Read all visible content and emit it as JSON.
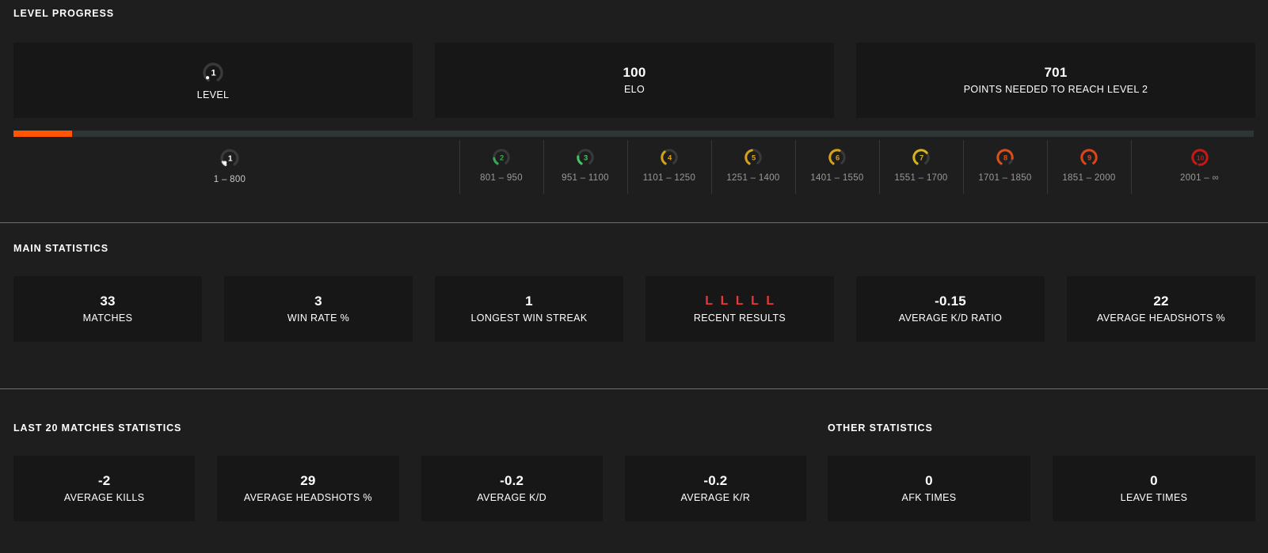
{
  "theme": {
    "page_bg": "#1e1e1e",
    "card_bg": "#171717",
    "accent_orange": "#ff5500",
    "loss_red": "#e33a3a",
    "muted_text": "#9a9a9a",
    "divider": "#6e6e6e"
  },
  "level_progress": {
    "title": "LEVEL PROGRESS",
    "cards": [
      {
        "type": "level-badge",
        "badge_number": "1",
        "label": "LEVEL"
      },
      {
        "type": "value",
        "value": "100",
        "label": "ELO"
      },
      {
        "type": "value",
        "value": "701",
        "label": "POINTS NEEDED TO REACH LEVEL 2"
      }
    ],
    "progress": {
      "percent": 4.7,
      "fill_color": "#ff5500",
      "track_color": "#2e3536"
    },
    "tiers": [
      {
        "level": "1",
        "range": "1 – 800",
        "color": "#d8d8d8",
        "arc_pct": 8,
        "current": true
      },
      {
        "level": "2",
        "range": "801 – 950",
        "color": "#2fae52",
        "arc_pct": 14,
        "current": false
      },
      {
        "level": "3",
        "range": "951 – 1100",
        "color": "#3fc95f",
        "arc_pct": 18,
        "current": false
      },
      {
        "level": "4",
        "range": "1101 – 1250",
        "color": "#d8a216",
        "arc_pct": 30,
        "current": false
      },
      {
        "level": "5",
        "range": "1251 – 1400",
        "color": "#d8a216",
        "arc_pct": 38,
        "current": false
      },
      {
        "level": "6",
        "range": "1401 – 1550",
        "color": "#d8a216",
        "arc_pct": 46,
        "current": false
      },
      {
        "level": "7",
        "range": "1551 – 1700",
        "color": "#d8b516",
        "arc_pct": 55,
        "current": false
      },
      {
        "level": "8",
        "range": "1701 – 1850",
        "color": "#dd4f16",
        "arc_pct": 68,
        "current": false
      },
      {
        "level": "9",
        "range": "1851 – 2000",
        "color": "#dd4516",
        "arc_pct": 80,
        "current": false
      },
      {
        "level": "10",
        "range": "2001 – ∞",
        "color": "#cc1616",
        "arc_pct": 92,
        "current": false
      }
    ]
  },
  "main_statistics": {
    "title": "MAIN STATISTICS",
    "cards": [
      {
        "value": "33",
        "label": "MATCHES"
      },
      {
        "value": "3",
        "label": "WIN RATE %"
      },
      {
        "value": "1",
        "label": "LONGEST WIN STREAK"
      },
      {
        "value": "",
        "label": "RECENT RESULTS",
        "results": [
          "L",
          "L",
          "L",
          "L",
          "L"
        ]
      },
      {
        "value": "-0.15",
        "label": "AVERAGE K/D RATIO"
      },
      {
        "value": "22",
        "label": "AVERAGE HEADSHOTS %"
      }
    ]
  },
  "last_20_matches": {
    "title": "LAST 20 MATCHES STATISTICS",
    "cards": [
      {
        "value": "-2",
        "label": "AVERAGE KILLS"
      },
      {
        "value": "29",
        "label": "AVERAGE HEADSHOTS %"
      },
      {
        "value": "-0.2",
        "label": "AVERAGE K/D"
      },
      {
        "value": "-0.2",
        "label": "AVERAGE K/R"
      }
    ]
  },
  "other_statistics": {
    "title": "OTHER STATISTICS",
    "cards": [
      {
        "value": "0",
        "label": "AFK TIMES"
      },
      {
        "value": "0",
        "label": "LEAVE TIMES"
      }
    ]
  }
}
